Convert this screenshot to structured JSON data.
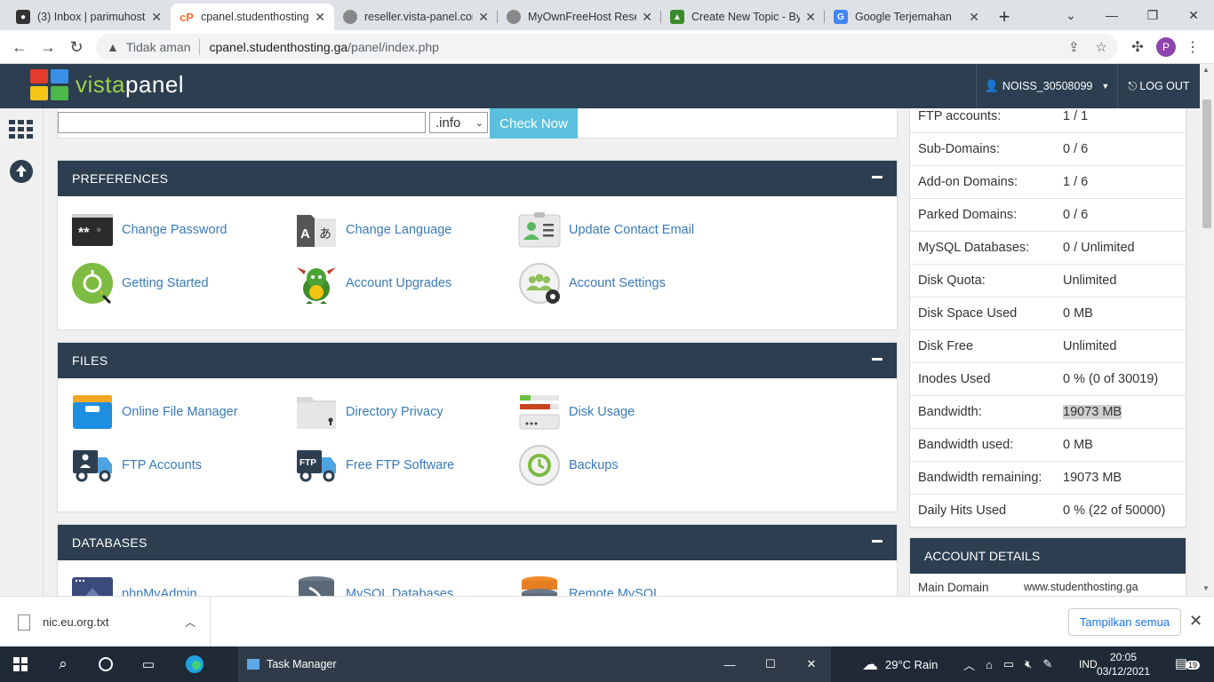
{
  "browser": {
    "tabs": [
      {
        "title": "(3) Inbox | parimuhost",
        "active": false
      },
      {
        "title": "cpanel.studenthosting",
        "active": true
      },
      {
        "title": "reseller.vista-panel.com",
        "active": false
      },
      {
        "title": "MyOwnFreeHost Rese",
        "active": false
      },
      {
        "title": "Create New Topic - By",
        "active": false
      },
      {
        "title": "Google Terjemahan",
        "active": false
      }
    ],
    "security_label": "Tidak aman",
    "url_host": "cpanel.studenthosting.ga",
    "url_path": "/panel/index.php",
    "profile_initial": "P"
  },
  "header": {
    "logo_prefix": "vista",
    "logo_suffix": "panel",
    "username": "NOISS_30508099",
    "logout_label": "LOG OUT"
  },
  "domain_search": {
    "input_value": "",
    "tld_selected": ".info",
    "button_label": "Check Now"
  },
  "preferences": {
    "title": "PREFERENCES",
    "items": [
      {
        "label": "Change Password",
        "icon": "password-icon"
      },
      {
        "label": "Change Language",
        "icon": "language-icon"
      },
      {
        "label": "Update Contact Email",
        "icon": "contact-card-icon"
      },
      {
        "label": "Getting Started",
        "icon": "getting-started-icon"
      },
      {
        "label": "Account Upgrades",
        "icon": "dragon-icon"
      },
      {
        "label": "Account Settings",
        "icon": "account-settings-icon"
      }
    ]
  },
  "files": {
    "title": "FILES",
    "items": [
      {
        "label": "Online File Manager",
        "icon": "file-manager-icon"
      },
      {
        "label": "Directory Privacy",
        "icon": "folder-lock-icon"
      },
      {
        "label": "Disk Usage",
        "icon": "disk-usage-icon"
      },
      {
        "label": "FTP Accounts",
        "icon": "ftp-truck-icon"
      },
      {
        "label": "Free FTP Software",
        "icon": "ftp-software-icon"
      },
      {
        "label": "Backups",
        "icon": "backup-icon"
      }
    ]
  },
  "databases": {
    "title": "DATABASES",
    "items": [
      {
        "label": "phpMyAdmin",
        "icon": "phpmyadmin-icon"
      },
      {
        "label": "MySQL Databases",
        "icon": "mysql-icon"
      },
      {
        "label": "Remote MySQL",
        "icon": "remote-mysql-icon"
      }
    ]
  },
  "stats": [
    {
      "key": "FTP accounts:",
      "value": "1 / 1"
    },
    {
      "key": "Sub-Domains:",
      "value": "0 / 6"
    },
    {
      "key": "Add-on Domains:",
      "value": "1 / 6"
    },
    {
      "key": "Parked Domains:",
      "value": "0 / 6"
    },
    {
      "key": "MySQL Databases:",
      "value": "0 / Unlimited"
    },
    {
      "key": "Disk Quota:",
      "value": "Unlimited"
    },
    {
      "key": "Disk Space Used",
      "value": "0 MB"
    },
    {
      "key": "Disk Free",
      "value": "Unlimited"
    },
    {
      "key": "Inodes Used",
      "value": "0 % (0 of 30019)"
    },
    {
      "key": "Bandwidth:",
      "value": "19073 MB"
    },
    {
      "key": "Bandwidth used:",
      "value": "0 MB"
    },
    {
      "key": "Bandwidth remaining:",
      "value": "19073 MB"
    },
    {
      "key": "Daily Hits Used",
      "value": "0 % (22 of 50000)"
    }
  ],
  "account_details": {
    "title": "ACCOUNT DETAILS",
    "main_domain_label": "Main Domain",
    "main_domain_value": "www.studenthosting.ga"
  },
  "downloads": {
    "file_name": "nic.eu.org.txt",
    "show_all_label": "Tampilkan semua"
  },
  "taskbar": {
    "app_name": "Task Manager",
    "weather": "29°C  Rain",
    "language": "IND",
    "time": "20:05",
    "date": "03/12/2021",
    "notifications": "19"
  },
  "colors": {
    "header_bg": "#2c3e50",
    "link": "#3a7ab8",
    "check_button": "#5bc0de"
  }
}
